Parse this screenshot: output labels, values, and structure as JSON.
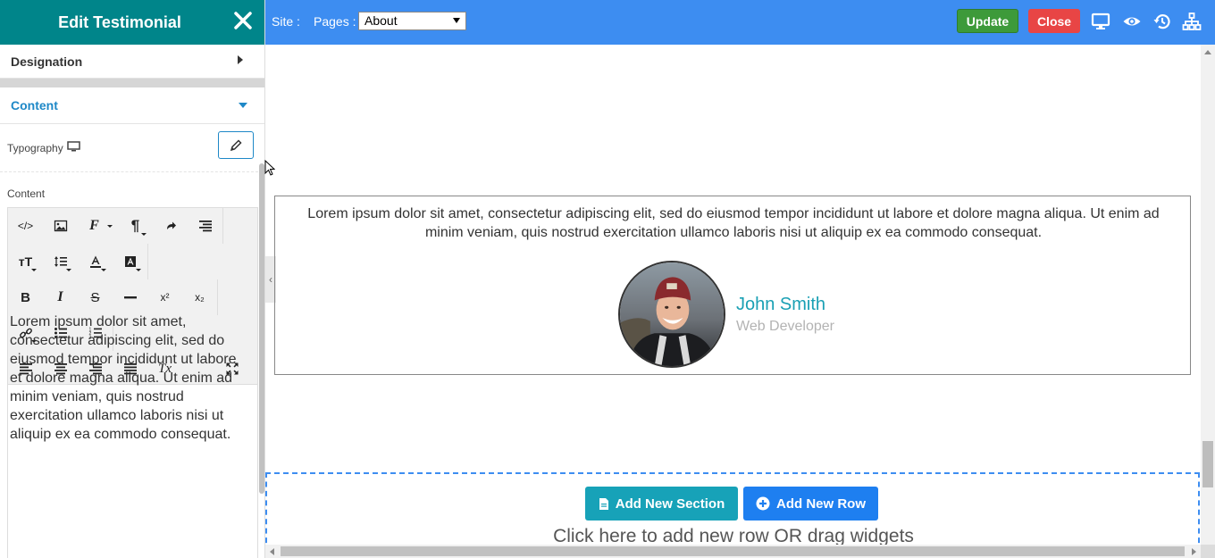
{
  "panel": {
    "title": "Edit Testimonial",
    "designation_label": "Designation",
    "content_section_label": "Content",
    "typography_label": "Typography",
    "content_field_label": "Content",
    "editor_text": "Lorem ipsum dolor sit amet, consectetur adipiscing elit, sed do eiusmod tempor incididunt ut labore et dolore magna aliqua. Ut enim ad minim veniam, quis nostrud exercitation ullamco laboris nisi ut aliquip ex ea commodo consequat.",
    "toolbar_glyphs": {
      "code": "</>",
      "font": "F",
      "paragraph": "¶",
      "text_size": "тT",
      "bold": "B",
      "italic": "I",
      "strike": "S",
      "superscript": "x²",
      "subscript": "x₂",
      "clear_format": "Tx"
    }
  },
  "topbar": {
    "site_label": "Site :",
    "pages_label": "Pages :",
    "pages_selected": "About",
    "update_label": "Update",
    "close_label": "Close"
  },
  "testimonial": {
    "text": "Lorem ipsum dolor sit amet, consectetur adipiscing elit, sed do eiusmod tempor incididunt ut labore et dolore magna aliqua. Ut enim ad minim veniam, quis nostrud exercitation ullamco laboris nisi ut aliquip ex ea commodo consequat.",
    "name": "John Smith",
    "role": "Web Developer"
  },
  "dropzone": {
    "add_section_label": "Add New Section",
    "add_row_label": "Add New Row",
    "hint": "Click here to add new row OR drag widgets"
  },
  "colors": {
    "panel_header": "#00858a",
    "topbar": "#3d8df1",
    "update": "#3d9a3a",
    "close": "#e84545",
    "accent_blue": "#1e88c7",
    "name_color": "#1aa0b4",
    "add_section": "#17a2b8",
    "add_row": "#1e7ff0"
  }
}
